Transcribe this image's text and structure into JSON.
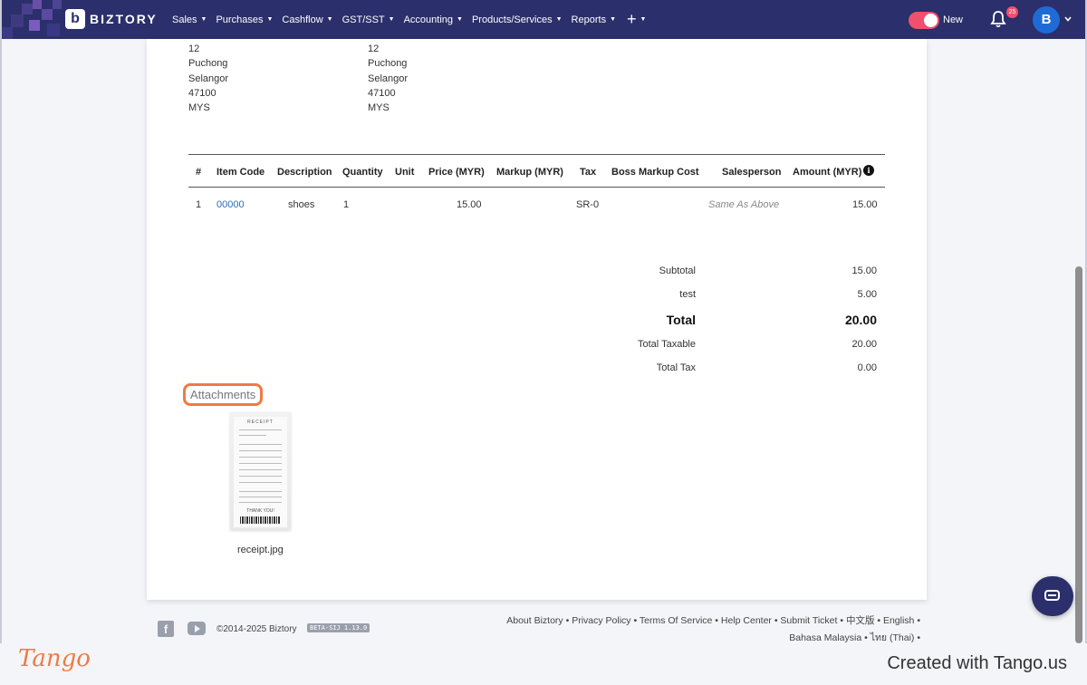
{
  "navbar": {
    "brand": "BIZTORY",
    "brand_mark": "b",
    "menu": [
      "Sales",
      "Purchases",
      "Cashflow",
      "GST/SST",
      "Accounting",
      "Products/Services",
      "Reports"
    ],
    "plus": "+",
    "new_label": "New",
    "notification_count": "25",
    "avatar_initial": "B",
    "colors": {
      "bar": "#2b2f6b",
      "toggle": "#f04f6d",
      "avatar": "#1e6bd6"
    }
  },
  "addresses": [
    {
      "lines": [
        "12",
        "Puchong",
        "Selangor",
        "47100",
        "MYS"
      ]
    },
    {
      "lines": [
        "12",
        "Puchong",
        "Selangor",
        "47100",
        "MYS"
      ]
    }
  ],
  "table": {
    "headers": [
      "#",
      "Item Code",
      "Description",
      "Quantity",
      "Unit",
      "Price (MYR)",
      "Markup (MYR)",
      "Tax",
      "Boss Markup Cost",
      "Salesperson",
      "Amount (MYR)"
    ],
    "rows": [
      [
        "1",
        "00000",
        "shoes",
        "1",
        "",
        "15.00",
        "",
        "SR-0",
        "",
        "Same As Above",
        "15.00"
      ]
    ]
  },
  "summary": [
    {
      "label": "Subtotal",
      "value": "15.00"
    },
    {
      "label": "test",
      "value": "5.00"
    },
    {
      "label": "Total",
      "value": "20.00"
    },
    {
      "label": "Total Taxable",
      "value": "20.00"
    },
    {
      "label": "Total Tax",
      "value": "0.00"
    }
  ],
  "attachments": {
    "title": "Attachments",
    "files": [
      {
        "name": "receipt.jpg",
        "thumb_header": "RECEIPT",
        "thumb_footer": "THANK YOU!"
      }
    ]
  },
  "footer": {
    "copyright": "©2014-2025 Biztory",
    "version": "BETA-SIJ 1.13.0",
    "links_line1": "About Biztory • Privacy Policy • Terms Of Service • Help Center • Submit Ticket • 中文版 • English •",
    "links_line2": "Bahasa Malaysia • ไทย (Thai) •"
  },
  "tango": {
    "logo": "Tango",
    "credit": "Created with Tango.us",
    "accent": "#ee7b45"
  }
}
